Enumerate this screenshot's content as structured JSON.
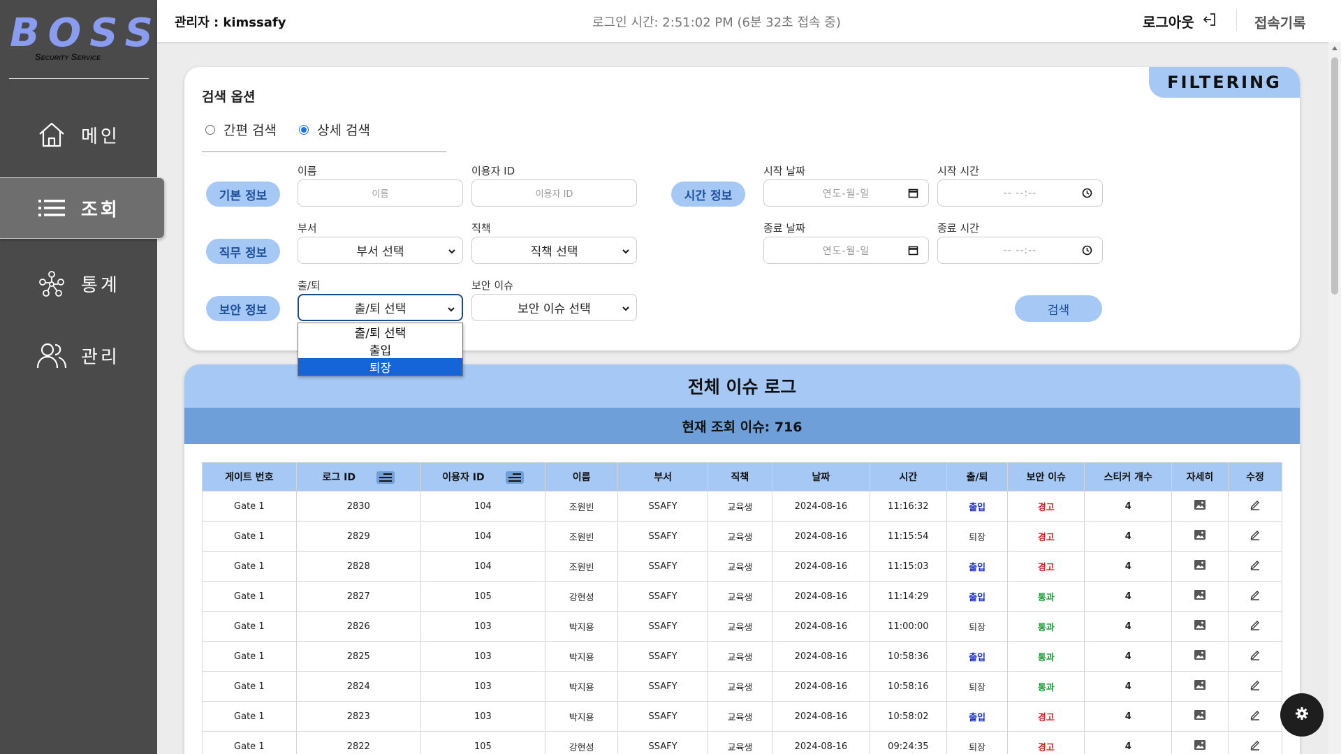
{
  "brand": {
    "name": "BOSS",
    "tagline": "Security Service"
  },
  "sidebar": {
    "items": [
      {
        "label": "메인",
        "icon": "home-icon"
      },
      {
        "label": "조회",
        "icon": "list-icon",
        "active": true
      },
      {
        "label": "통계",
        "icon": "network-icon"
      },
      {
        "label": "관리",
        "icon": "users-icon"
      }
    ]
  },
  "header": {
    "admin": "관리자 : kimssafy",
    "login_time": "로그인 시간: 2:51:02 PM (6분 32초 접속 중)",
    "logout": "로그아웃",
    "history": "접속기록"
  },
  "filter": {
    "tag": "FILTERING",
    "title": "검색 옵션",
    "radio_simple": "간편 검색",
    "radio_detail": "상세 검색",
    "selected_mode": "상세 검색",
    "sections": {
      "basic": "기본 정보",
      "job": "직무 정보",
      "security": "보안 정보",
      "time": "시간 정보"
    },
    "labels": {
      "name": "이름",
      "user_id": "이용자 ID",
      "dept": "부서",
      "position": "직책",
      "inout": "출/퇴",
      "issue": "보안 이슈",
      "start_date": "시작 날짜",
      "start_time": "시작 시간",
      "end_date": "종료 날짜",
      "end_time": "종료 시간"
    },
    "placeholders": {
      "name": "이름",
      "user_id": "이용자 ID",
      "date": "연도-월-일",
      "time": "-- --:--"
    },
    "selects": {
      "dept": "부서 선택",
      "position": "직책 선택",
      "inout": "출/퇴 선택",
      "issue": "보안 이슈 선택"
    },
    "search_button": "검색",
    "dropdown": {
      "options": [
        "출/퇴 선택",
        "출입",
        "퇴장"
      ],
      "highlighted": "퇴장"
    }
  },
  "log": {
    "title": "전체 이슈 로그",
    "count_text": "현재 조회 이슈: 716",
    "columns": [
      "게이트 번호",
      "로그 ID",
      "이용자 ID",
      "이름",
      "부서",
      "직책",
      "날짜",
      "시간",
      "출/퇴",
      "보안 이슈",
      "스티커 개수",
      "자세히",
      "수정"
    ],
    "rows": [
      {
        "gate": "Gate 1",
        "log_id": "2830",
        "user_id": "104",
        "name": "조원빈",
        "dept": "SSAFY",
        "position": "교육생",
        "date": "2024-08-16",
        "time": "11:16:32",
        "inout": "출입",
        "issue": "경고",
        "stickers": "4"
      },
      {
        "gate": "Gate 1",
        "log_id": "2829",
        "user_id": "104",
        "name": "조원빈",
        "dept": "SSAFY",
        "position": "교육생",
        "date": "2024-08-16",
        "time": "11:15:54",
        "inout": "퇴장",
        "issue": "경고",
        "stickers": "4"
      },
      {
        "gate": "Gate 1",
        "log_id": "2828",
        "user_id": "104",
        "name": "조원빈",
        "dept": "SSAFY",
        "position": "교육생",
        "date": "2024-08-16",
        "time": "11:15:03",
        "inout": "출입",
        "issue": "경고",
        "stickers": "4"
      },
      {
        "gate": "Gate 1",
        "log_id": "2827",
        "user_id": "105",
        "name": "강현성",
        "dept": "SSAFY",
        "position": "교육생",
        "date": "2024-08-16",
        "time": "11:14:29",
        "inout": "출입",
        "issue": "통과",
        "stickers": "4"
      },
      {
        "gate": "Gate 1",
        "log_id": "2826",
        "user_id": "103",
        "name": "박지용",
        "dept": "SSAFY",
        "position": "교육생",
        "date": "2024-08-16",
        "time": "11:00:00",
        "inout": "퇴장",
        "issue": "통과",
        "stickers": "4"
      },
      {
        "gate": "Gate 1",
        "log_id": "2825",
        "user_id": "103",
        "name": "박지용",
        "dept": "SSAFY",
        "position": "교육생",
        "date": "2024-08-16",
        "time": "10:58:36",
        "inout": "출입",
        "issue": "통과",
        "stickers": "4"
      },
      {
        "gate": "Gate 1",
        "log_id": "2824",
        "user_id": "103",
        "name": "박지용",
        "dept": "SSAFY",
        "position": "교육생",
        "date": "2024-08-16",
        "time": "10:58:16",
        "inout": "퇴장",
        "issue": "통과",
        "stickers": "4"
      },
      {
        "gate": "Gate 1",
        "log_id": "2823",
        "user_id": "103",
        "name": "박지용",
        "dept": "SSAFY",
        "position": "교육생",
        "date": "2024-08-16",
        "time": "10:58:02",
        "inout": "출입",
        "issue": "경고",
        "stickers": "4"
      },
      {
        "gate": "Gate 1",
        "log_id": "2822",
        "user_id": "105",
        "name": "강현성",
        "dept": "SSAFY",
        "position": "교육생",
        "date": "2024-08-16",
        "time": "09:24:35",
        "inout": "퇴장",
        "issue": "경고",
        "stickers": "4"
      }
    ]
  },
  "colors": {
    "accent": "#a5c8f4",
    "accent_dark": "#6e9fd8",
    "sidebar": "#4a4a4a",
    "in": "#1a2fc8",
    "warn": "#e0191c",
    "pass": "#1e9e3a"
  }
}
